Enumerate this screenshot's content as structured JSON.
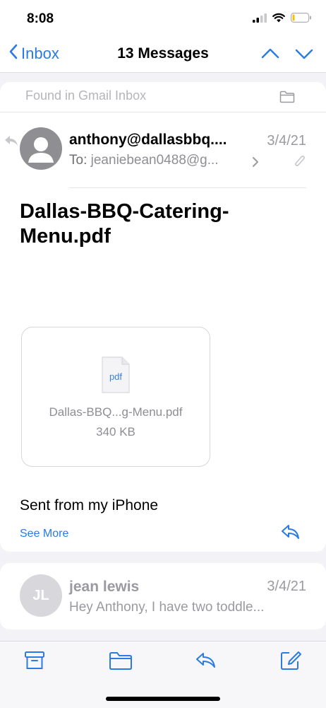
{
  "status": {
    "time": "8:08"
  },
  "nav": {
    "back_label": "Inbox",
    "title": "13 Messages"
  },
  "gmail": {
    "label": "Found in Gmail Inbox"
  },
  "message1": {
    "from": "anthony@dallasbbq....",
    "date": "3/4/21",
    "to_label": "To:",
    "to_value": "jeaniebean0488@g...",
    "subject": "Dallas-BBQ-Catering-Menu.pdf",
    "attachment": {
      "badge": "pdf",
      "name": "Dallas-BBQ...g-Menu.pdf",
      "size": "340 KB"
    },
    "body": "Sent from my iPhone",
    "see_more": "See More"
  },
  "message2": {
    "initials": "JL",
    "sender": "jean lewis",
    "date": "3/4/21",
    "snippet": "Hey Anthony, I have two toddle..."
  },
  "colors": {
    "accent": "#2a7be4",
    "secondary_text": "#8e8e93"
  },
  "icons": [
    "signal-icon",
    "wifi-icon",
    "battery-icon",
    "chevron-left-icon",
    "chevron-up-icon",
    "chevron-down-icon",
    "folder-icon",
    "reply-icon",
    "chevron-right-icon",
    "paperclip-icon",
    "pdf-file-icon",
    "archive-icon",
    "move-folder-icon",
    "reply-all-icon",
    "compose-icon"
  ]
}
